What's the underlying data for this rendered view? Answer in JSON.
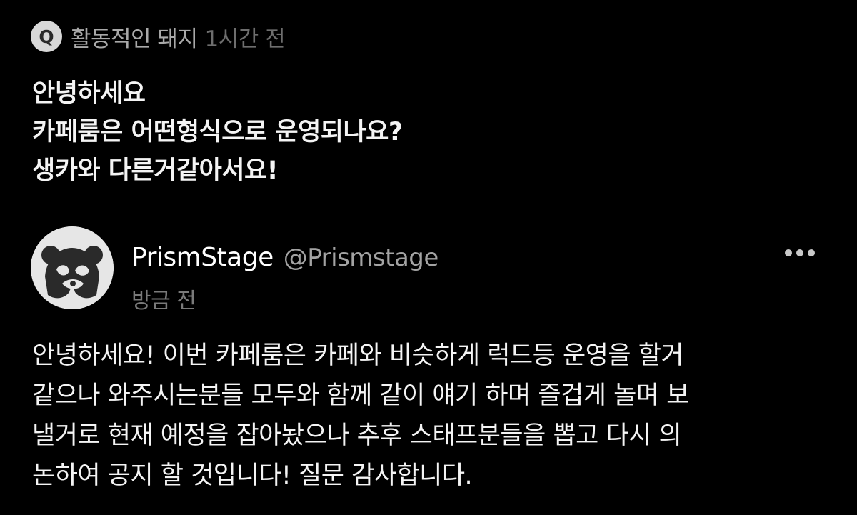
{
  "question": {
    "badge_letter": "Q",
    "author": "활동적인 돼지",
    "time": "1시간 전",
    "lines": [
      "안녕하세요",
      "카페룸은 어떤형식으로 운영되나요?",
      "생카와 다른거같아서요!"
    ]
  },
  "answer": {
    "avatar_icon": "panda-logo-icon",
    "name": "PrismStage",
    "handle": "@Prismstage",
    "time": "방금 전",
    "more_icon": "more-horizontal-icon",
    "lines": [
      "안녕하세요! 이번 카페룸은 카페와 비슷하게 럭드등 운영을 할거",
      "같으나 와주시는분들 모두와 함께 같이 얘기 하며 즐겁게 놀며 보",
      "낼거로 현재 예정을 잡아놨으나 추후 스태프분들을 뽑고 다시 의",
      "논하여 공지 할 것입니다! 질문 감사합니다."
    ]
  },
  "colors": {
    "background": "#000000",
    "primary_text": "#f4f4f4",
    "secondary_text": "#a9a9a9",
    "muted_text": "#6e6e6e"
  }
}
